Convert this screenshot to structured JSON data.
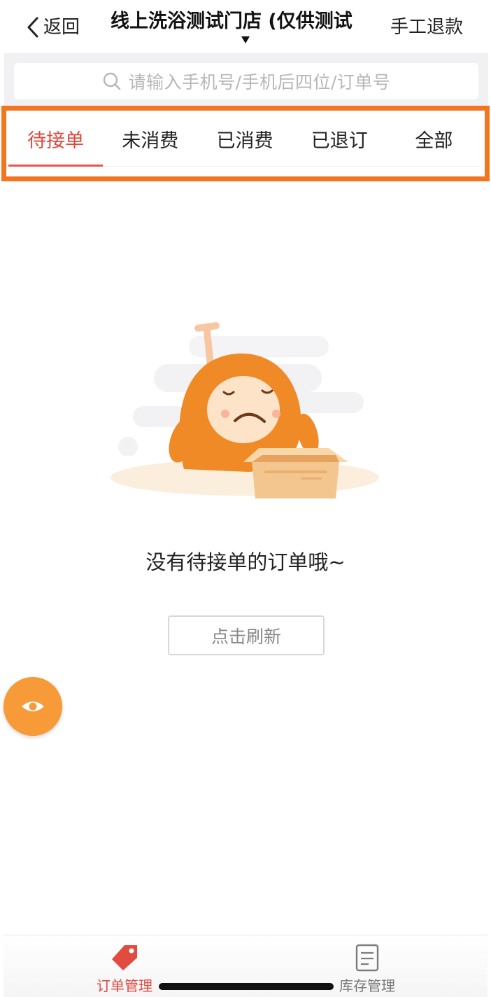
{
  "header": {
    "back_label": "返回",
    "title": "线上洗浴测试门店 (仅供测试",
    "refund_label": "手工退款"
  },
  "search": {
    "placeholder": "请输入手机号/手机后四位/订单号"
  },
  "tabs": [
    {
      "label": "待接单",
      "active": true
    },
    {
      "label": "未消费",
      "active": false
    },
    {
      "label": "已消费",
      "active": false
    },
    {
      "label": "已退订",
      "active": false
    },
    {
      "label": "全部",
      "active": false
    }
  ],
  "empty": {
    "message": "没有待接单的订单哦~",
    "refresh_label": "点击刷新"
  },
  "fab": {
    "icon": "eye-icon"
  },
  "bottom_nav": [
    {
      "label": "订单管理",
      "icon": "tag-icon",
      "active": true
    },
    {
      "label": "库存管理",
      "icon": "clipboard-icon",
      "active": false
    }
  ],
  "colors": {
    "accent": "#e0473c",
    "highlight_outline": "#f2751f",
    "fab": "#f79b39",
    "mascot": "#f08a26"
  }
}
